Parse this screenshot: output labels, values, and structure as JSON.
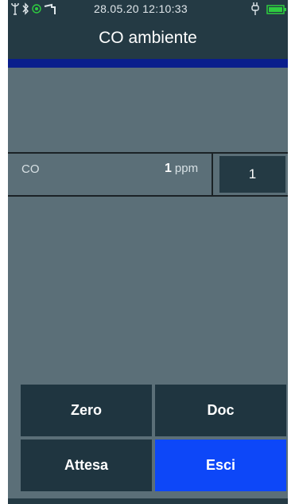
{
  "status_bar": {
    "datetime": "28.05.20 12:10:33",
    "icons": [
      "usb-icon",
      "bluetooth-icon",
      "location-icon",
      "probe-icon",
      "plug-icon",
      "battery-icon"
    ]
  },
  "header": {
    "title": "CO ambiente"
  },
  "measurement": {
    "label": "CO",
    "value": "1",
    "unit": "ppm",
    "count": "1"
  },
  "buttons": {
    "zero": "Zero",
    "doc": "Doc",
    "attesa": "Attesa",
    "esci": "Esci"
  },
  "colors": {
    "background": "#5b6f78",
    "header": "#243a44",
    "accent_bar": "#0a1e8c",
    "button": "#1f3540",
    "button_active": "#0d47f8",
    "battery": "#2ecc40"
  }
}
